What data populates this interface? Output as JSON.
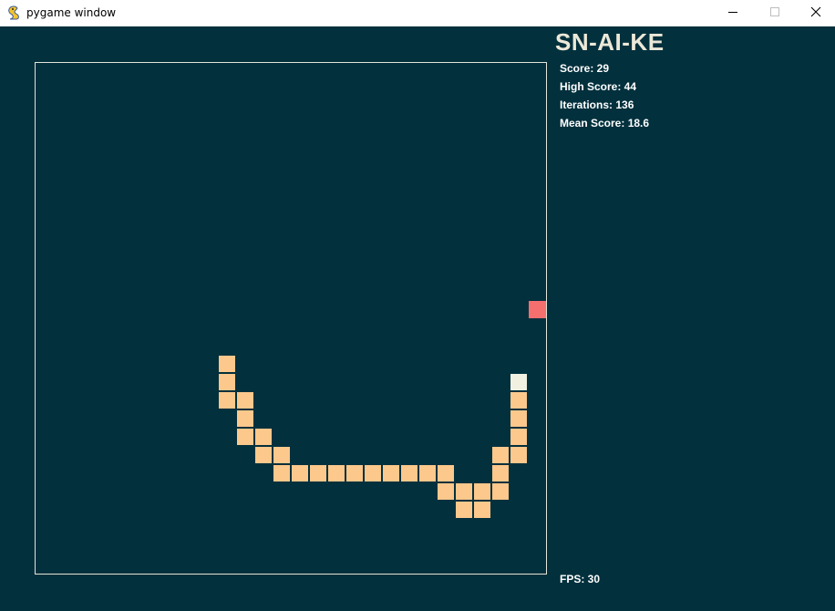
{
  "window": {
    "title": "pygame window",
    "app_icon": "pygame-snake-icon",
    "controls": {
      "minimize_icon": "minimize-icon",
      "maximize_icon": "maximize-icon",
      "close_icon": "close-icon"
    }
  },
  "hud": {
    "game_title": "SN-AI-KE",
    "score": "Score: 29",
    "high_score": "High Score: 44",
    "iterations": "Iterations: 136",
    "mean_score": "Mean Score: 18.6",
    "fps": "FPS: 30"
  },
  "colors": {
    "background": "#02303d",
    "board_border": "#e4e4d8",
    "snake_body": "#fcc88c",
    "snake_head": "#f2f0e0",
    "food": "#f56f6f",
    "text": "#ffffff"
  },
  "game": {
    "grid_columns": 28,
    "grid_rows": 28,
    "food_cell": [
      27,
      13
    ],
    "snake_cells": [
      [
        26,
        17
      ],
      [
        26,
        18
      ],
      [
        26,
        19
      ],
      [
        26,
        20
      ],
      [
        26,
        21
      ],
      [
        25,
        21
      ],
      [
        25,
        22
      ],
      [
        25,
        23
      ],
      [
        24,
        23
      ],
      [
        24,
        24
      ],
      [
        23,
        24
      ],
      [
        23,
        23
      ],
      [
        22,
        23
      ],
      [
        22,
        22
      ],
      [
        21,
        22
      ],
      [
        20,
        22
      ],
      [
        19,
        22
      ],
      [
        18,
        22
      ],
      [
        17,
        22
      ],
      [
        16,
        22
      ],
      [
        15,
        22
      ],
      [
        14,
        22
      ],
      [
        13,
        22
      ],
      [
        13,
        21
      ],
      [
        12,
        21
      ],
      [
        12,
        20
      ],
      [
        11,
        20
      ],
      [
        11,
        19
      ],
      [
        11,
        18
      ],
      [
        10,
        18
      ],
      [
        10,
        17
      ],
      [
        10,
        16
      ]
    ]
  }
}
